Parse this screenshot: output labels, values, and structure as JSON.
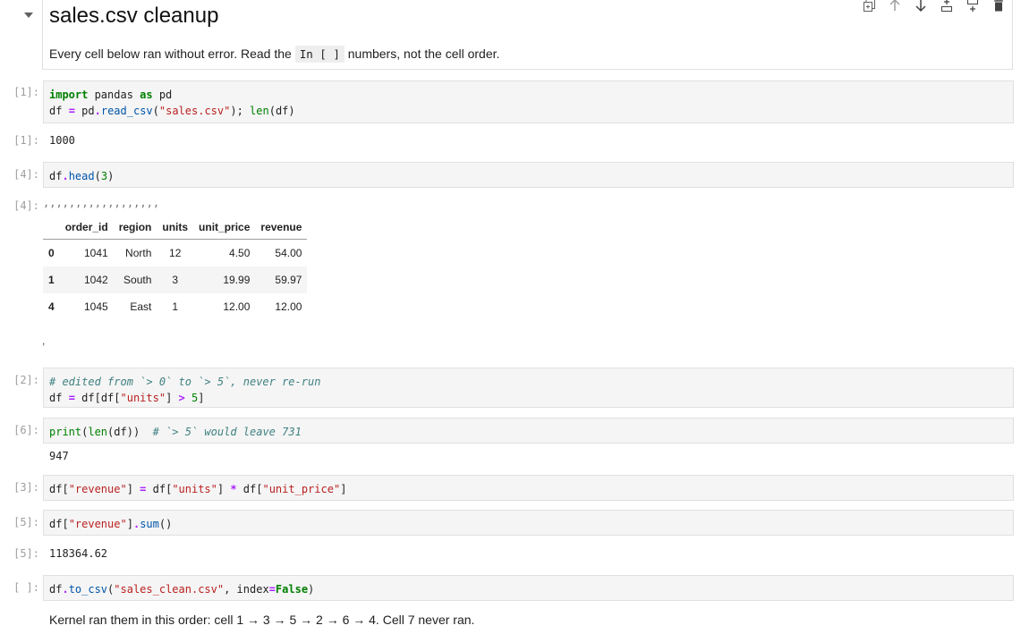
{
  "markdown": {
    "title": "sales.csv cleanup",
    "text_before": "Every cell below ran without error. Read the ",
    "inline_code": "In [ ]",
    "text_after": " numbers, not the cell order."
  },
  "cells": {
    "c1": {
      "prompt": "[1]:",
      "out_prompt": "[1]:",
      "output": "1000"
    },
    "c4": {
      "prompt": "[4]:",
      "out_prompt": "[4]:",
      "out_noise": ",,,,,,,,,,,,,,,,,,",
      "trailing": ","
    },
    "c2": {
      "prompt": "[2]:"
    },
    "c6": {
      "prompt": "[6]:",
      "output": "947"
    },
    "c3": {
      "prompt": "[3]:"
    },
    "c5": {
      "prompt": "[5]:",
      "out_prompt": "[5]:",
      "output": "118364.62"
    },
    "c7": {
      "prompt": "[ ]:"
    }
  },
  "table": {
    "columns": [
      "",
      "order_id",
      "region",
      "units",
      "unit_price",
      "revenue"
    ],
    "rows": [
      {
        "idx": "0",
        "order_id": "1041",
        "region": "North",
        "units": "12",
        "unit_price": "4.50",
        "revenue": "54.00"
      },
      {
        "idx": "1",
        "order_id": "1042",
        "region": "South",
        "units": "3",
        "unit_price": "19.99",
        "revenue": "59.97"
      },
      {
        "idx": "4",
        "order_id": "1045",
        "region": "East",
        "units": "1",
        "unit_price": "12.00",
        "revenue": "12.00"
      }
    ]
  },
  "footer": "Kernel ran them in this order: cell 1 → 3 → 5 → 2 → 6 → 4. Cell 7 never ran.",
  "toolbar_icons": [
    "duplicate-icon",
    "move-up-icon",
    "move-down-icon",
    "insert-above-icon",
    "insert-below-icon",
    "delete-icon"
  ]
}
